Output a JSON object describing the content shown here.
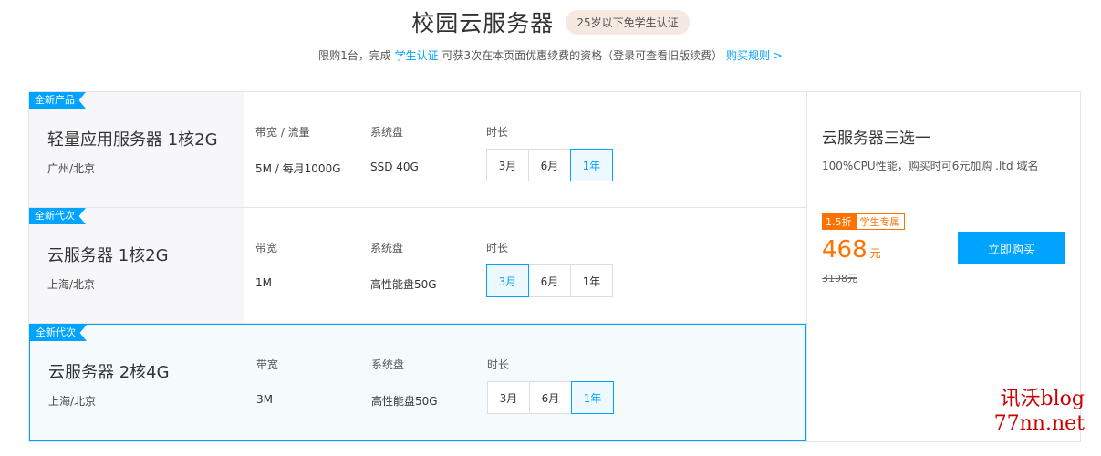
{
  "header": {
    "title": "校园云服务器",
    "badge": "25岁以下免学生认证",
    "sub_pre": "限购1台，完成",
    "sub_link": "学生认证",
    "sub_post": "可获3次在本页面优惠续费的资格（登录可查看旧版续费）",
    "rules_link": "购买规则 >"
  },
  "products": [
    {
      "tag": "全新产品",
      "name": "轻量应用服务器 1核2G",
      "region": "广州/北京",
      "bandwidth_label": "带宽 / 流量",
      "bandwidth_value": "5M / 每月1000G",
      "disk_label": "系统盘",
      "disk_value": "SSD 40G",
      "duration_label": "时长",
      "durations": [
        "3月",
        "6月",
        "1年"
      ],
      "selected_duration": "1年"
    },
    {
      "tag": "全新代次",
      "name": "云服务器 1核2G",
      "region": "上海/北京",
      "bandwidth_label": "带宽",
      "bandwidth_value": "1M",
      "disk_label": "系统盘",
      "disk_value": "高性能盘50G",
      "duration_label": "时长",
      "durations": [
        "3月",
        "6月",
        "1年"
      ],
      "selected_duration": "3月"
    },
    {
      "tag": "全新代次",
      "name": "云服务器 2核4G",
      "region": "上海/北京",
      "bandwidth_label": "带宽",
      "bandwidth_value": "3M",
      "disk_label": "系统盘",
      "disk_value": "高性能盘50G",
      "duration_label": "时长",
      "durations": [
        "3月",
        "6月",
        "1年"
      ],
      "selected_duration": "1年"
    }
  ],
  "side": {
    "title": "云服务器三选一",
    "desc": "100%CPU性能，购买时可6元加购 .ltd 域名",
    "discount": "1.5折",
    "student": "学生专属",
    "price": "468",
    "unit": "元",
    "original": "3198元",
    "buy_label": "立即购买"
  },
  "watermark": {
    "line1": "讯沃blog",
    "line2": "77nn.net"
  },
  "colors": {
    "accent": "#00a4ff",
    "price": "#ff7200"
  }
}
